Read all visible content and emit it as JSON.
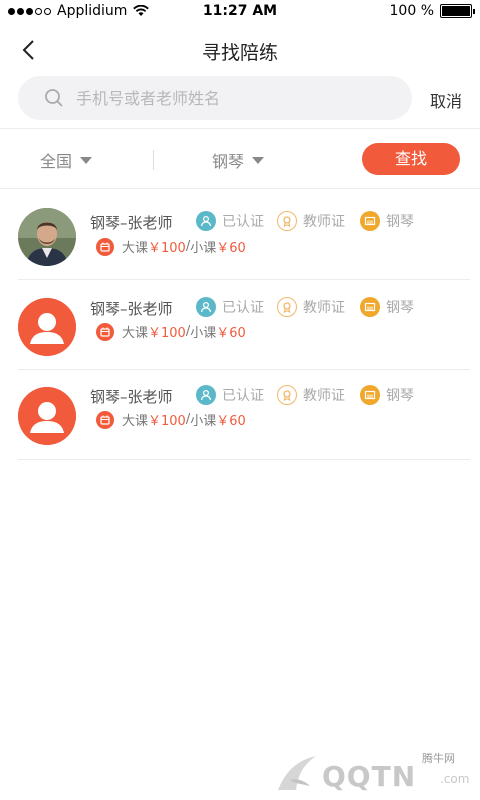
{
  "status_bar": {
    "carrier": "Applidium",
    "time": "11:27 AM",
    "battery_text": "100 %",
    "battery_level": 1.0
  },
  "nav": {
    "title": "寻找陪练",
    "back_icon": "chevron-left-icon"
  },
  "search": {
    "placeholder": "手机号或者老师姓名",
    "cancel_label": "取消"
  },
  "filters": {
    "region": "全国",
    "instrument": "钢琴",
    "search_button": "查找"
  },
  "colors": {
    "accent": "#f25a3c",
    "verified": "#5bb8c9",
    "certificate": "#f2b76a",
    "piano_badge": "#f0a82c"
  },
  "teachers": [
    {
      "name": "钢琴–张老师",
      "avatar": "photo",
      "verified": "已认证",
      "certificate": "教师证",
      "instrument": "钢琴",
      "price_big_label": "大课",
      "price_big": "￥100",
      "price_sep": "/",
      "price_small_label": "小课",
      "price_small": "￥60"
    },
    {
      "name": "钢琴–张老师",
      "avatar": "default",
      "verified": "已认证",
      "certificate": "教师证",
      "instrument": "钢琴",
      "price_big_label": "大课",
      "price_big": "￥100",
      "price_sep": "/",
      "price_small_label": "小课",
      "price_small": "￥60"
    },
    {
      "name": "钢琴–张老师",
      "avatar": "default",
      "verified": "已认证",
      "certificate": "教师证",
      "instrument": "钢琴",
      "price_big_label": "大课",
      "price_big": "￥100",
      "price_sep": "/",
      "price_small_label": "小课",
      "price_small": "￥60"
    }
  ],
  "watermark": {
    "site_name": "腾牛网",
    "logo_text": "QQTN",
    "logo_suffix": ".com"
  }
}
